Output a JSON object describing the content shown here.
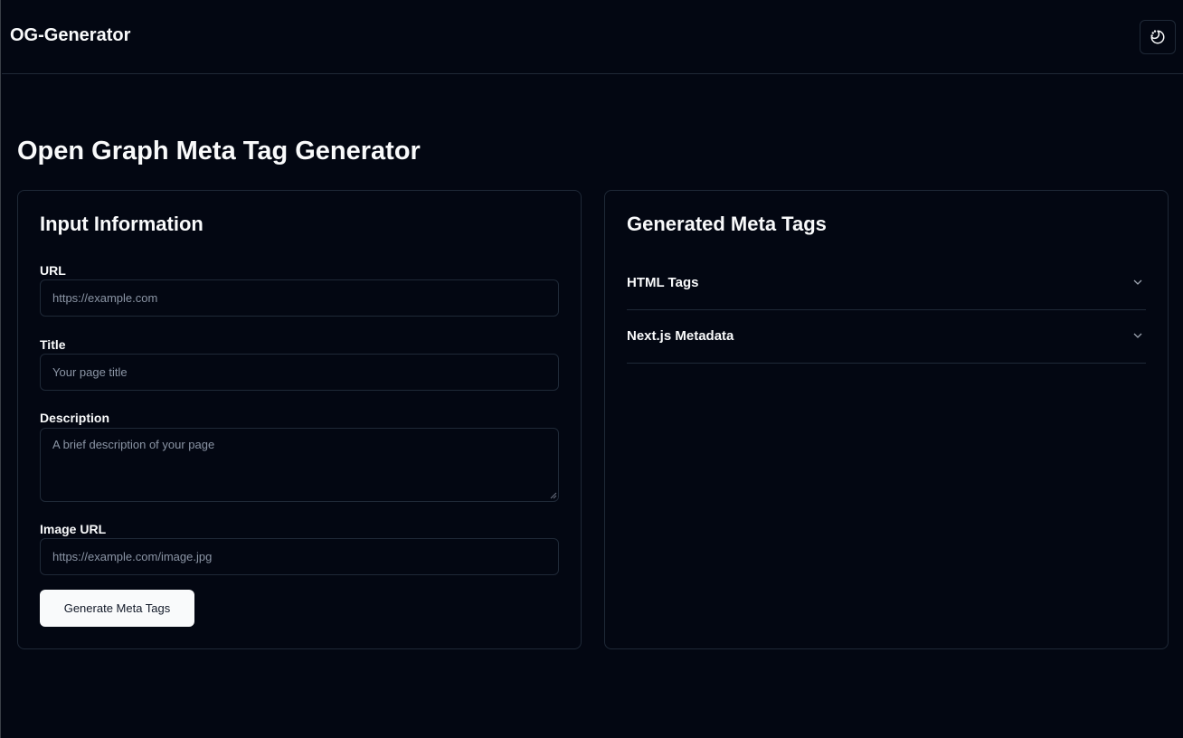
{
  "header": {
    "brand": "OG-Generator",
    "theme_toggle_icon": "moon-stars-icon"
  },
  "page": {
    "title": "Open Graph Meta Tag Generator"
  },
  "input_card": {
    "title": "Input Information",
    "fields": {
      "url": {
        "label": "URL",
        "placeholder": "https://example.com",
        "value": ""
      },
      "title": {
        "label": "Title",
        "placeholder": "Your page title",
        "value": ""
      },
      "description": {
        "label": "Description",
        "placeholder": "A brief description of your page",
        "value": ""
      },
      "image_url": {
        "label": "Image URL",
        "placeholder": "https://example.com/image.jpg",
        "value": ""
      }
    },
    "generate_label": "Generate Meta Tags"
  },
  "output_card": {
    "title": "Generated Meta Tags",
    "sections": [
      {
        "label": "HTML Tags",
        "expanded": false
      },
      {
        "label": "Next.js Metadata",
        "expanded": false
      }
    ]
  },
  "colors": {
    "background": "#030712",
    "border": "#1f2937",
    "text": "#f9fafb",
    "muted": "#8b95a5",
    "button_bg": "#f9fafb",
    "button_text": "#111827"
  }
}
